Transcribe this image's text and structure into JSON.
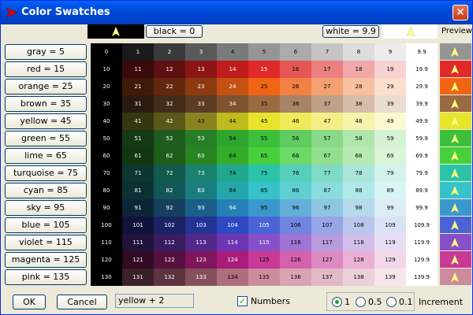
{
  "window": {
    "title": "Color Swatches",
    "close_label": "✕"
  },
  "header": {
    "black_button": "black = 0",
    "white_button": "white = 9.9",
    "preview_label": "Preview"
  },
  "families": [
    {
      "label": "gray = 5"
    },
    {
      "label": "red = 15"
    },
    {
      "label": "orange = 25"
    },
    {
      "label": "brown = 35"
    },
    {
      "label": "yellow = 45"
    },
    {
      "label": "green = 55"
    },
    {
      "label": "lime = 65"
    },
    {
      "label": "turquoise = 75"
    },
    {
      "label": "cyan = 85"
    },
    {
      "label": "sky = 95"
    },
    {
      "label": "blue = 105"
    },
    {
      "label": "violet = 115"
    },
    {
      "label": "magenta = 125"
    },
    {
      "label": "pink = 135"
    }
  ],
  "grid": {
    "rows": [
      {
        "base": 0,
        "colors": [
          "#000000",
          "#1a1a1a",
          "#3a3a3a",
          "#595959",
          "#7a7a7a",
          "#959595",
          "#ababab",
          "#c4c4c4",
          "#dddddd",
          "#ececec",
          "#ffffff"
        ]
      },
      {
        "base": 10,
        "colors": [
          "#000000",
          "#3a0a0a",
          "#5e1010",
          "#8b1515",
          "#c01c1c",
          "#e02a2a",
          "#e65656",
          "#ec8080",
          "#f2a8a8",
          "#f8d2d2",
          "#ffffff"
        ]
      },
      {
        "base": 20,
        "colors": [
          "#000000",
          "#3e1b08",
          "#63280c",
          "#8c3a10",
          "#c45012",
          "#f06414",
          "#f28244",
          "#f4a070",
          "#f7c09e",
          "#fbdfcc",
          "#ffffff"
        ]
      },
      {
        "base": 30,
        "colors": [
          "#000000",
          "#2a1b10",
          "#432b1a",
          "#5c3c24",
          "#80532f",
          "#9a6a43",
          "#a88464",
          "#bfa088",
          "#d6bdaa",
          "#ebdcd0",
          "#ffffff"
        ]
      },
      {
        "base": 40,
        "colors": [
          "#000000",
          "#363610",
          "#5a5818",
          "#878420",
          "#bfba1e",
          "#e8e42c",
          "#eeea5a",
          "#f2ef86",
          "#f6f4aa",
          "#fbf9d2",
          "#ffffff"
        ]
      },
      {
        "base": 50,
        "colors": [
          "#000000",
          "#143a14",
          "#1d5c1d",
          "#267f26",
          "#2ea62e",
          "#3cc03c",
          "#60cc60",
          "#88d888",
          "#aee6ae",
          "#d6f2d6",
          "#ffffff"
        ]
      },
      {
        "base": 60,
        "colors": [
          "#000000",
          "#12360f",
          "#1e5c18",
          "#2b8422",
          "#36ac2c",
          "#48d03c",
          "#6cd866",
          "#92e08e",
          "#b6eab2",
          "#daf4d8",
          "#ffffff"
        ]
      },
      {
        "base": 70,
        "colors": [
          "#000000",
          "#0c3630",
          "#125a4e",
          "#1a826f",
          "#20a88f",
          "#2cc4a8",
          "#56cfb8",
          "#80dac8",
          "#aae6da",
          "#d4f2ec",
          "#ffffff"
        ]
      },
      {
        "base": 80,
        "colors": [
          "#000000",
          "#0d3033",
          "#145558",
          "#1b7d82",
          "#23a7ad",
          "#36c2c8",
          "#60cfd4",
          "#8adcde",
          "#b0e8ea",
          "#d8f4f4",
          "#ffffff"
        ]
      },
      {
        "base": 90,
        "colors": [
          "#000000",
          "#0c2638",
          "#14405e",
          "#1c5e8a",
          "#2480b6",
          "#3a98cc",
          "#64b0d8",
          "#8ec6e2",
          "#b4daec",
          "#dcedf6",
          "#ffffff"
        ]
      },
      {
        "base": 100,
        "colors": [
          "#000000",
          "#10143c",
          "#1a2466",
          "#243494",
          "#2e48c2",
          "#4a64d6",
          "#7086de",
          "#96a6e6",
          "#bac6ee",
          "#dce2f6",
          "#ffffff"
        ]
      },
      {
        "base": 110,
        "colors": [
          "#000000",
          "#201238",
          "#381c5e",
          "#52288a",
          "#6c36b2",
          "#8650c8",
          "#a074d4",
          "#b89ade",
          "#d2beea",
          "#e8def4",
          "#ffffff"
        ]
      },
      {
        "base": 120,
        "colors": [
          "#000000",
          "#320a24",
          "#56103e",
          "#80165c",
          "#aa1c7a",
          "#c83a96",
          "#d462ac",
          "#de8ac2",
          "#eab0d6",
          "#f4d8ea",
          "#ffffff"
        ]
      },
      {
        "base": 130,
        "colors": [
          "#000000",
          "#3a2028",
          "#5c3440",
          "#84505e",
          "#ae6e80",
          "#cc8c9e",
          "#d8a4b4",
          "#e2bac6",
          "#ecd0d8",
          "#f6e6ea",
          "#ffffff"
        ]
      }
    ],
    "number_labels": [
      [
        "0",
        "1",
        "2",
        "3",
        "4",
        "5",
        "6",
        "7",
        "8",
        "9",
        "9.9"
      ],
      [
        "10",
        "11",
        "12",
        "13",
        "14",
        "15",
        "16",
        "17",
        "18",
        "19",
        "19.9"
      ],
      [
        "20",
        "21",
        "22",
        "23",
        "24",
        "25",
        "26",
        "27",
        "28",
        "29",
        "29.9"
      ],
      [
        "30",
        "31",
        "32",
        "33",
        "34",
        "35",
        "36",
        "37",
        "38",
        "39",
        "39.9"
      ],
      [
        "40",
        "41",
        "42",
        "43",
        "44",
        "45",
        "46",
        "47",
        "48",
        "49",
        "49.9"
      ],
      [
        "50",
        "51",
        "52",
        "53",
        "54",
        "55",
        "56",
        "57",
        "58",
        "59",
        "59.9"
      ],
      [
        "60",
        "61",
        "62",
        "63",
        "64",
        "65",
        "66",
        "67",
        "68",
        "69",
        "69.9"
      ],
      [
        "70",
        "71",
        "72",
        "73",
        "74",
        "75",
        "76",
        "77",
        "78",
        "79",
        "79.9"
      ],
      [
        "80",
        "81",
        "82",
        "83",
        "84",
        "85",
        "86",
        "87",
        "88",
        "89",
        "89.9"
      ],
      [
        "90",
        "91",
        "92",
        "93",
        "94",
        "95",
        "96",
        "97",
        "98",
        "99",
        "99.9"
      ],
      [
        "100",
        "101",
        "102",
        "103",
        "104",
        "105",
        "106",
        "107",
        "108",
        "109",
        "109.9"
      ],
      [
        "110",
        "111",
        "112",
        "113",
        "114",
        "115",
        "116",
        "117",
        "118",
        "119",
        "119.9"
      ],
      [
        "120",
        "121",
        "122",
        "123",
        "124",
        "125",
        "126",
        "127",
        "128",
        "129",
        "129.9"
      ],
      [
        "130",
        "131",
        "132",
        "133",
        "134",
        "135",
        "136",
        "137",
        "138",
        "139",
        "139.9"
      ]
    ]
  },
  "preview": {
    "arrow_color": "#ffff80",
    "colors": [
      "#959595",
      "#e02a2a",
      "#f06414",
      "#9a6a43",
      "#e8e42c",
      "#3cc03c",
      "#48d03c",
      "#2cc4a8",
      "#36c2c8",
      "#3a98cc",
      "#4a64d6",
      "#8650c8",
      "#c83a96",
      "#cc8c9e"
    ]
  },
  "footer": {
    "ok_label": "OK",
    "cancel_label": "Cancel",
    "edit_value": "yellow + 2",
    "numbers_label": "Numbers",
    "numbers_checked": true,
    "increment_options": [
      "1",
      "0.5",
      "0.1"
    ],
    "increment_selected": "1",
    "increment_label": "Increment"
  },
  "colors": {
    "title_bar": "#0047d6",
    "title_arrow": "#e00000",
    "dialog_bg": "#ece9d8"
  }
}
